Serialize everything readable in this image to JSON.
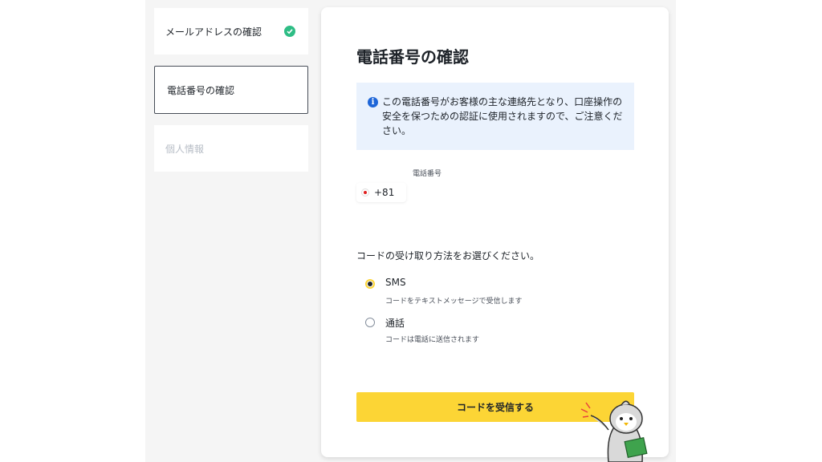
{
  "steps": [
    {
      "label": "メールアドレスの確認",
      "status": "done"
    },
    {
      "label": "電話番号の確認",
      "status": "active"
    },
    {
      "label": "個人情報",
      "status": "pending"
    }
  ],
  "main": {
    "title": "電話番号の確認",
    "info_text": "この電話番号がお客様の主な連絡先となり、口座操作の安全を保つための認証に使用されますので、ご注意ください。",
    "phone_label": "電話番号",
    "country_code": "+81",
    "method_question": "コードの受け取り方法をお選びください。",
    "options": [
      {
        "title": "SMS",
        "desc": "コードをテキストメッセージで受信します",
        "selected": true
      },
      {
        "title": "通話",
        "desc": "コードは電話に送信されます",
        "selected": false
      }
    ],
    "submit_label": "コードを受信する"
  },
  "colors": {
    "accent": "#fcd535",
    "success": "#2ebd85",
    "info_bg": "#eaf2fd",
    "info_icon": "#1e66d8"
  },
  "icons": {
    "done": "check-circle-icon",
    "info": "info-circle-icon",
    "flag": "japan-flag-icon"
  }
}
